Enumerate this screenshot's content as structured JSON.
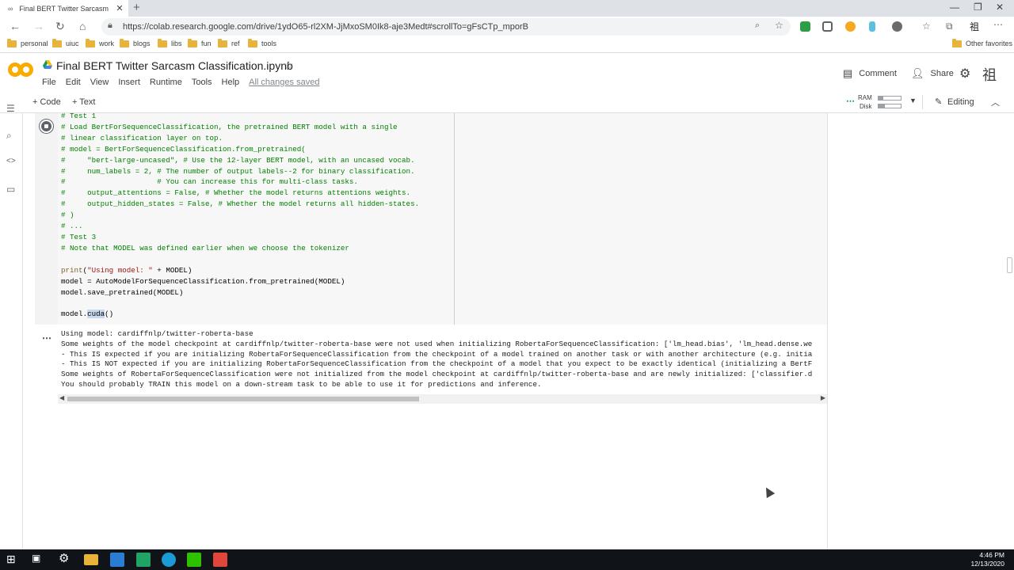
{
  "browser": {
    "tab_title": "Final BERT Twitter Sarcasm Classi",
    "new_tab": "+",
    "url": "https://colab.research.google.com/drive/1ydO65-rl2XM-JjMxoSM0Ik8-aje3Medt#scrollTo=gFsCTp_mporB",
    "bookmarks": [
      "personal",
      "uiuc",
      "work",
      "blogs",
      "libs",
      "fun",
      "ref",
      "tools"
    ],
    "other_favorites": "Other favorites"
  },
  "colab": {
    "logo": "CO",
    "title": "Final BERT Twitter Sarcasm Classification.ipynb",
    "menu": [
      "File",
      "Edit",
      "View",
      "Insert",
      "Runtime",
      "Tools",
      "Help"
    ],
    "saved_status": "All changes saved",
    "comment_label": "Comment",
    "share_label": "Share",
    "avatar_glyph": "祖",
    "add_code": "+ Code",
    "add_text": "+ Text",
    "ram_label": "RAM",
    "disk_label": "Disk",
    "ram_fraction": 0.2,
    "disk_fraction": 0.3,
    "editing_label": "Editing"
  },
  "cell": {
    "code_lines": [
      {
        "cls": "cm",
        "text": "# Test 1"
      },
      {
        "cls": "cm",
        "text": "# Load BertForSequenceClassification, the pretrained BERT model with a single"
      },
      {
        "cls": "cm",
        "text": "# linear classification layer on top."
      },
      {
        "cls": "cm",
        "text": "# model = BertForSequenceClassification.from_pretrained("
      },
      {
        "cls": "cm",
        "text": "#     \"bert-large-uncased\", # Use the 12-layer BERT model, with an uncased vocab."
      },
      {
        "cls": "cm",
        "text": "#     num_labels = 2, # The number of output labels--2 for binary classification."
      },
      {
        "cls": "cm",
        "text": "#                     # You can increase this for multi-class tasks."
      },
      {
        "cls": "cm",
        "text": "#     output_attentions = False, # Whether the model returns attentions weights."
      },
      {
        "cls": "cm",
        "text": "#     output_hidden_states = False, # Whether the model returns all hidden-states."
      },
      {
        "cls": "cm",
        "text": "# )"
      },
      {
        "cls": "cm",
        "text": "# ..."
      },
      {
        "cls": "cm",
        "text": "# Test 3"
      },
      {
        "cls": "cm",
        "text": "# Note that MODEL was defined earlier when we choose the tokenizer"
      },
      {
        "cls": "txt",
        "text": ""
      },
      {
        "cls": "print",
        "text": "print(\"Using model: \" + MODEL)"
      },
      {
        "cls": "txt",
        "text": "model = AutoModelForSequenceClassification.from_pretrained(MODEL)"
      },
      {
        "cls": "txt",
        "text": "model.save_pretrained(MODEL)"
      },
      {
        "cls": "txt",
        "text": ""
      },
      {
        "cls": "cuda",
        "text": "model.cuda()"
      }
    ],
    "output_lines": [
      "Using model: cardiffnlp/twitter-roberta-base",
      "Some weights of the model checkpoint at cardiffnlp/twitter-roberta-base were not used when initializing RobertaForSequenceClassification: ['lm_head.bias', 'lm_head.dense.we",
      "- This IS expected if you are initializing RobertaForSequenceClassification from the checkpoint of a model trained on another task or with another architecture (e.g. initia",
      "- This IS NOT expected if you are initializing RobertaForSequenceClassification from the checkpoint of a model that you expect to be exactly identical (initializing a BertF",
      "Some weights of RobertaForSequenceClassification were not initialized from the model checkpoint at cardiffnlp/twitter-roberta-base and are newly initialized: ['classifier.d",
      "You should probably TRAIN this model on a down-stream task to be able to use it for predictions and inference."
    ]
  },
  "taskbar": {
    "time": "4:46 PM",
    "date": "12/13/2020"
  }
}
